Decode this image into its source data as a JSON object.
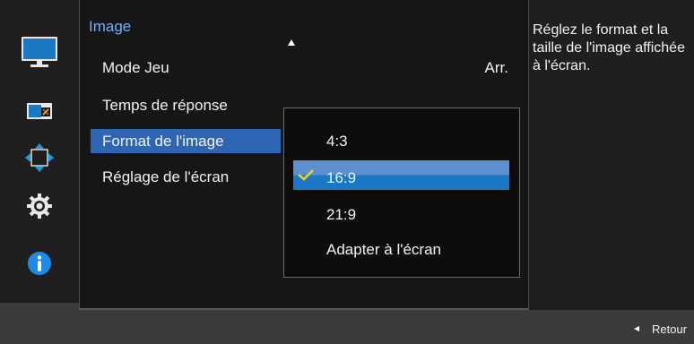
{
  "panel": {
    "title": "Image",
    "items": [
      {
        "label": "Mode Jeu",
        "value": "Arr."
      },
      {
        "label": "Temps de réponse"
      },
      {
        "label": "Format de l'image",
        "selected": true
      },
      {
        "label": "Réglage de l'écran"
      }
    ]
  },
  "dropdown": {
    "options": [
      "4:3",
      "16:9",
      "21:9",
      "Adapter à l'écran"
    ],
    "selected": "16:9"
  },
  "help": {
    "text": "Réglez le format et la taille de l'image affichée à l'écran."
  },
  "footer": {
    "back_label": "Retour"
  },
  "nav_icons": [
    "monitor-icon",
    "picture-in-picture-icon",
    "resize-arrows-icon",
    "gear-icon",
    "info-icon"
  ],
  "colors": {
    "accent": "#2f66b3",
    "title": "#6fb1ff",
    "check": "#f5d21a",
    "info": "#1e8ae6"
  }
}
